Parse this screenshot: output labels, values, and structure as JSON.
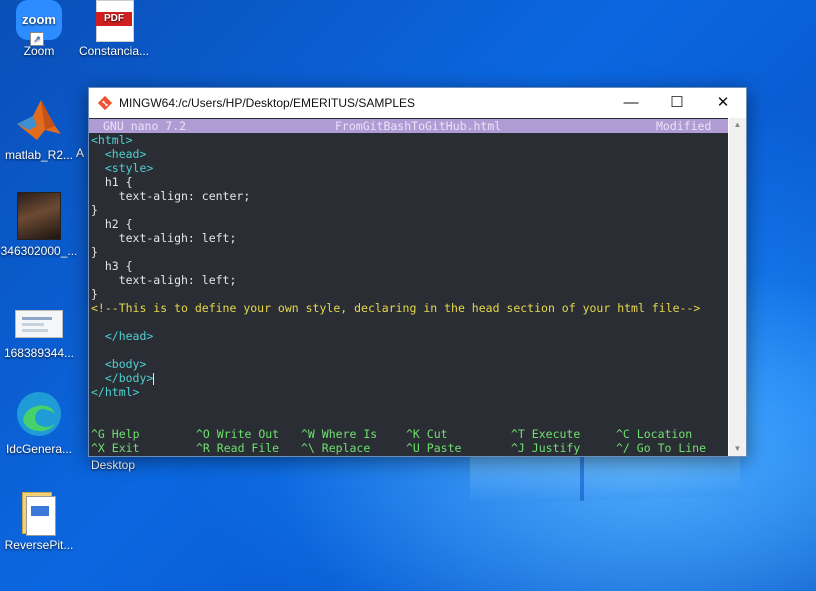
{
  "desktop": {
    "icons": [
      {
        "label": "Zoom",
        "icon": "zoom-icon"
      },
      {
        "label": "Constancia...",
        "icon": "pdf-icon"
      },
      {
        "label": "matlab_R2...",
        "icon": "matlab-icon"
      },
      {
        "label": "A",
        "icon": "partial-icon"
      },
      {
        "label": "346302000_...",
        "icon": "photo-icon"
      },
      {
        "label": "168389344...",
        "icon": "document-thumbnail-icon"
      },
      {
        "label": "IdcGenera...",
        "icon": "edge-icon"
      },
      {
        "label": "Desktop",
        "icon": "desktop-folder-label"
      },
      {
        "label": "ReversePit...",
        "icon": "folder-icon"
      }
    ],
    "pdf_badge": "PDF",
    "zoom_text": "zoom"
  },
  "window": {
    "title": "MINGW64:/c/Users/HP/Desktop/EMERITUS/SAMPLES",
    "minimize": "—",
    "maximize": "☐",
    "close": "✕"
  },
  "nano": {
    "version": "GNU nano 7.2",
    "filename": "FromGitBashToGitHub.html",
    "status": "Modified",
    "lines": [
      "<html>",
      "  <head>",
      "  <style>",
      "  h1 {",
      "    text-align: center;",
      "}",
      "  h2 {",
      "    text-aligh: left;",
      "}",
      "  h3 {",
      "    text-aligh: left;",
      "}",
      "<!--This is to define your own style, declaring in the head section of your html file-->",
      "",
      "  </head>",
      "",
      "  <body>",
      "  </body>",
      "</html>"
    ],
    "shortcuts_row1": [
      {
        "key": "^G",
        "label": "Help"
      },
      {
        "key": "^O",
        "label": "Write Out"
      },
      {
        "key": "^W",
        "label": "Where Is"
      },
      {
        "key": "^K",
        "label": "Cut"
      },
      {
        "key": "^T",
        "label": "Execute"
      },
      {
        "key": "^C",
        "label": "Location"
      }
    ],
    "shortcuts_row2": [
      {
        "key": "^X",
        "label": "Exit"
      },
      {
        "key": "^R",
        "label": "Read File"
      },
      {
        "key": "^\\",
        "label": "Replace"
      },
      {
        "key": "^U",
        "label": "Paste"
      },
      {
        "key": "^J",
        "label": "Justify"
      },
      {
        "key": "^/",
        "label": "Go To Line"
      }
    ]
  },
  "colors": {
    "terminal_bg": "#2a2d34",
    "header_bg": "#b09cd4",
    "tag": "#4fd1d1",
    "comment": "#e6d94a",
    "shortcut_key": "#6fe06f"
  }
}
